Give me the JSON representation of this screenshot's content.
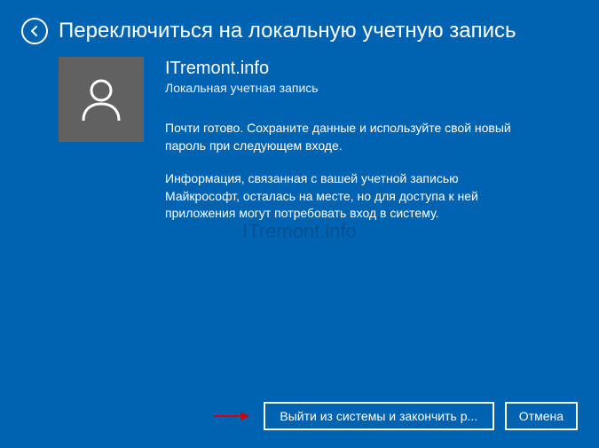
{
  "header": {
    "title": "Переключиться на локальную учетную запись"
  },
  "account": {
    "username": "ITremont.info",
    "type_label": "Локальная учетная запись"
  },
  "messages": {
    "ready": "Почти готово. Сохраните данные и используйте свой новый пароль при следующем входе.",
    "info": "Информация, связанная с вашей учетной записью Майкрософт, осталась на месте, но для доступа к ней приложения могут потребовать вход в систему."
  },
  "watermark": "ITremont.info",
  "buttons": {
    "signout": "Выйти из системы и закончить р...",
    "cancel": "Отмена"
  }
}
